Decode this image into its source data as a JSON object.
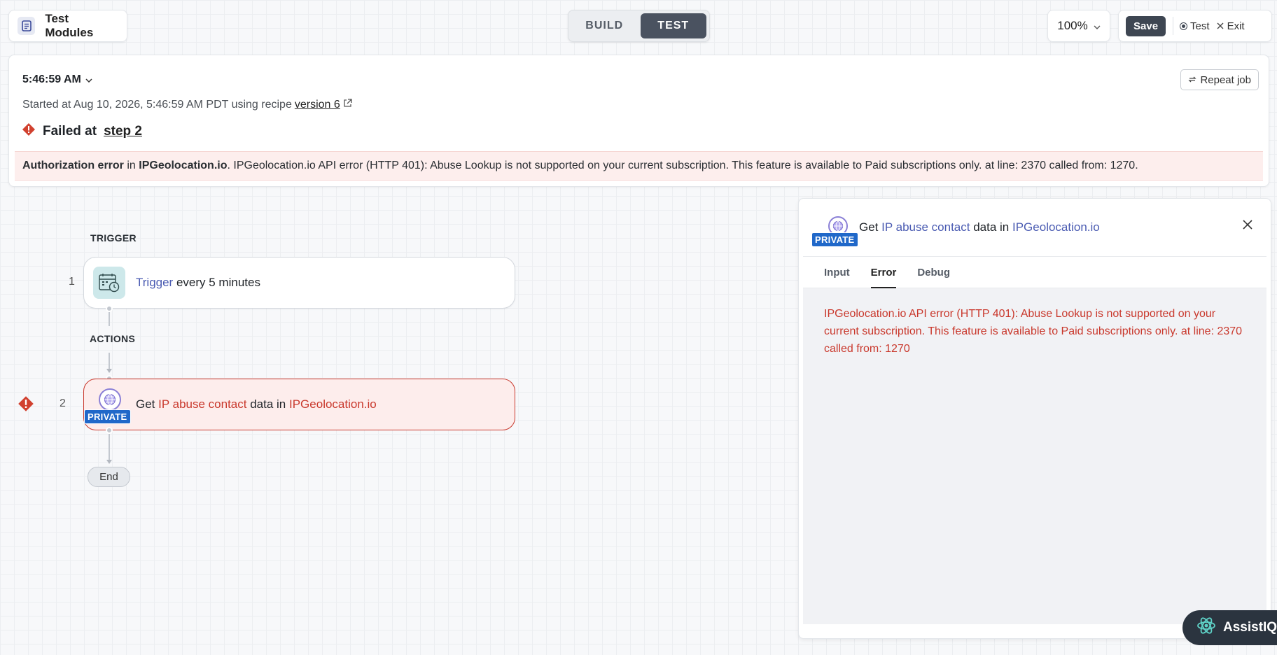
{
  "header": {
    "title": "Test Modules",
    "modes": {
      "build": "BUILD",
      "test": "TEST"
    },
    "zoom": "100%",
    "save_label": "Save",
    "test_label": "Test",
    "exit_label": "Exit"
  },
  "job": {
    "time": "5:46:59 AM",
    "started_prefix": "Started at Aug 10, 2026, 5:46:59 AM PDT using recipe",
    "version_link": "version 6",
    "failed_prefix": "Failed at",
    "failed_step": "step 2",
    "repeat_label": "Repeat job",
    "error": {
      "type": "Authorization error",
      "in_word": "in",
      "app": "IPGeolocation.io",
      "message": ". IPGeolocation.io API error (HTTP 401): Abuse Lookup is not supported on your current subscription. This feature is available to Paid subscriptions only. at line: 2370 called from: 1270."
    }
  },
  "flow": {
    "trigger_label": "TRIGGER",
    "actions_label": "ACTIONS",
    "end_label": "End",
    "steps": [
      {
        "num": "1",
        "link": "Trigger",
        "rest": "every 5 minutes"
      },
      {
        "num": "2",
        "get": "Get",
        "link": "IP abuse contact",
        "mid": "data in",
        "app": "IPGeolocation.io",
        "badge": "PRIVATE"
      }
    ]
  },
  "detail": {
    "get": "Get",
    "link": "IP abuse contact",
    "mid": "data in",
    "app": "IPGeolocation.io",
    "badge": "PRIVATE",
    "tabs": [
      "Input",
      "Error",
      "Debug"
    ],
    "active_tab": "Error",
    "error_lines": [
      "IPGeolocation.io API error (HTTP 401): Abuse Lookup is not supported on your current subscription. This feature is available to Paid subscriptions only. at line: 2370",
      "called from: 1270"
    ]
  },
  "assist": {
    "label": "AssistIQ"
  },
  "colors": {
    "accent": "#4a5bb2",
    "error": "#c9382c",
    "private": "#2068c9",
    "dark": "#3e4652"
  }
}
